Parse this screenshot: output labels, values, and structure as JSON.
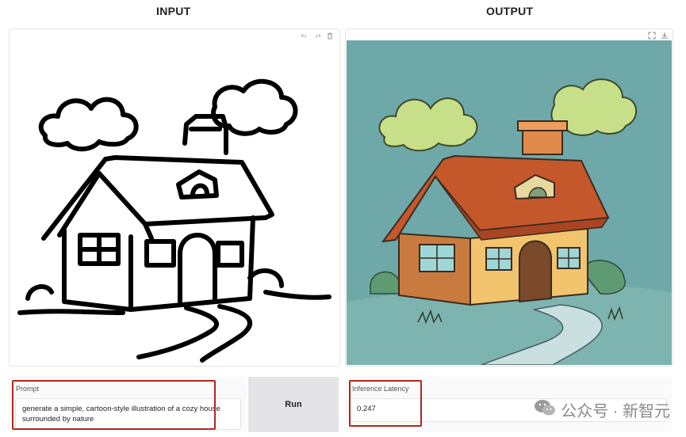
{
  "input": {
    "title": "INPUT",
    "prompt_label": "Prompt",
    "prompt_value": "generate a simple, cartoon-style illustration of a cozy house surrounded by nature",
    "run_label": "Run"
  },
  "output": {
    "title": "OUTPUT",
    "latency_label": "Inference Latency",
    "latency_value": "0.247"
  },
  "watermark": {
    "text": "公众号 · 新智元"
  },
  "colors": {
    "sky": "#6fa8a8",
    "cloud": "#c8df8a",
    "roof": "#c4582b",
    "wall": "#f1c46d",
    "highlight": "#b3261e"
  }
}
